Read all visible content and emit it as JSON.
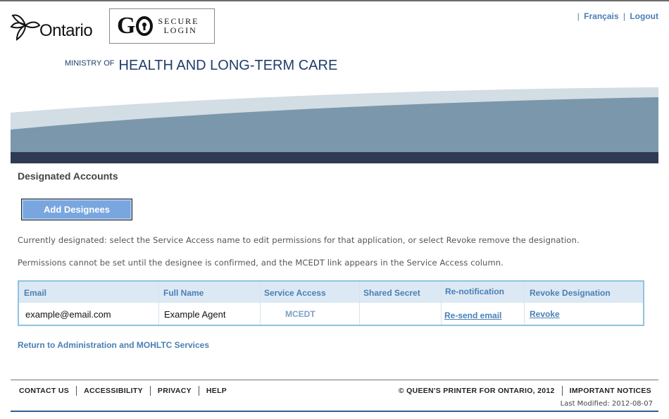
{
  "header": {
    "ontario_wordmark": "Ontario",
    "go_secure": {
      "go": "G",
      "secure": "SECURE",
      "login": "LOGIN"
    },
    "top_links": {
      "francais": "Français",
      "logout": "Logout"
    },
    "ministry_small": "MINISTRY OF",
    "ministry_big": "HEALTH AND LONG-TERM CARE"
  },
  "page": {
    "heading": "Designated Accounts",
    "add_button": "Add Designees",
    "para1": "Currently designated: select the Service Access name to edit permissions for that application, or select Revoke remove the designation.",
    "para2": "Permissions cannot be set until the designee is confirmed, and the MCEDT link appears in the Service Access column."
  },
  "table": {
    "headers": {
      "email": "Email",
      "full_name": "Full Name",
      "service_access": "Service Access",
      "shared_secret": "Shared Secret",
      "renotification": "Re-notification",
      "revoke": "Revoke Designation"
    },
    "rows": [
      {
        "email": "example@email.com",
        "full_name": "Example Agent",
        "service_access": "MCEDT",
        "shared_secret": "",
        "renotification": "Re-send email",
        "revoke": "Revoke"
      }
    ]
  },
  "return_link": "Return to Administration and MOHLTC Services",
  "footer": {
    "nav": [
      "CONTACT US",
      "ACCESSIBILITY",
      "PRIVACY",
      "HELP"
    ],
    "copyright": "© QUEEN'S PRINTER FOR ONTARIO, 2012",
    "important_notices": "IMPORTANT NOTICES",
    "last_modified": "Last Modified: 2012-08-07"
  },
  "colors": {
    "link": "#4a7fb5",
    "ministry_text": "#1f3d6b",
    "button_bg": "#79a6df",
    "table_header_bg": "#dce9f4",
    "table_border": "#8ec3e0"
  }
}
